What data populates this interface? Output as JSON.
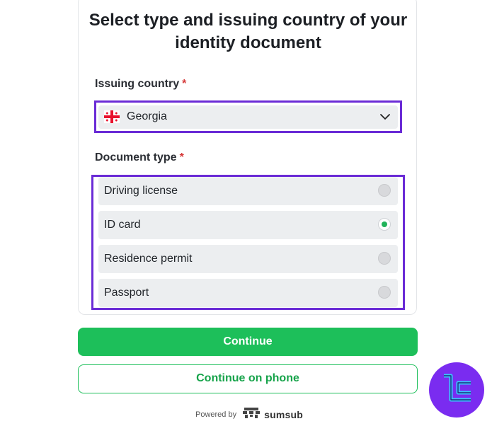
{
  "form": {
    "title": "Select type and issuing country of your identity document",
    "country_label": "Issuing country",
    "country_required": "*",
    "country_value": "Georgia",
    "doc_label": "Document type",
    "doc_required": "*",
    "options": [
      {
        "label": "Driving license",
        "selected": false
      },
      {
        "label": "ID card",
        "selected": true
      },
      {
        "label": "Residence permit",
        "selected": false
      },
      {
        "label": "Passport",
        "selected": false
      }
    ]
  },
  "actions": {
    "continue_label": "Continue",
    "continue_phone_label": "Continue on phone"
  },
  "footer": {
    "powered_by": "Powered by",
    "brand": "sumsub"
  },
  "colors": {
    "accent_green": "#1dbf5a",
    "highlight_purple": "#6a2bd6",
    "required_red": "#d63a3a",
    "badge_purple": "#7a2cf0"
  },
  "icons": {
    "flag": "georgia-flag-icon",
    "dropdown": "chevron-down-icon",
    "brand_logo": "sumsub-logo-icon",
    "badge": "tc-logo-icon"
  }
}
